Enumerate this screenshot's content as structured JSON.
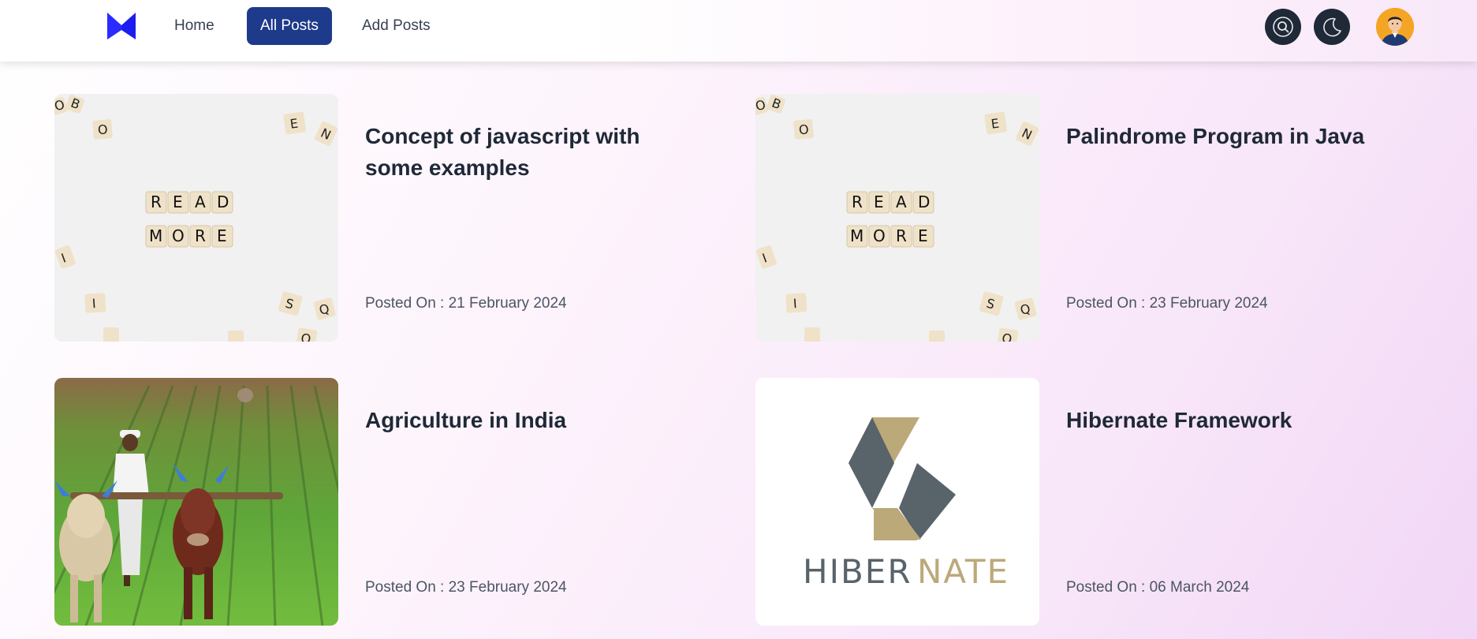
{
  "nav": {
    "logo_icon": "m-logo-icon",
    "links": [
      "Home",
      "All Posts",
      "Add Posts"
    ],
    "active": "All Posts",
    "accent_color": "#1e3a8a",
    "icons": [
      "search-icon",
      "moon-icon",
      "user-avatar"
    ]
  },
  "posts": [
    {
      "title": "Concept of javascript with some examples",
      "date": "Posted On : 21 February 2024",
      "image": "scrabble-read-more",
      "image_text": [
        "R",
        "E",
        "A",
        "D",
        "M",
        "O",
        "R",
        "E"
      ]
    },
    {
      "title": "Palindrome Program in Java",
      "date": "Posted On : 23 February 2024",
      "image": "scrabble-read-more",
      "image_text": [
        "R",
        "E",
        "A",
        "D",
        "M",
        "O",
        "R",
        "E"
      ]
    },
    {
      "title": "Agriculture in India",
      "date": "Posted On : 23 February 2024",
      "image": "farmer-with-oxen-plough"
    },
    {
      "title": "Hibernate Framework",
      "date": "Posted On : 06 March 2024",
      "image": "hibernate-logo",
      "image_text": [
        "HIBER",
        "NATE"
      ]
    }
  ]
}
